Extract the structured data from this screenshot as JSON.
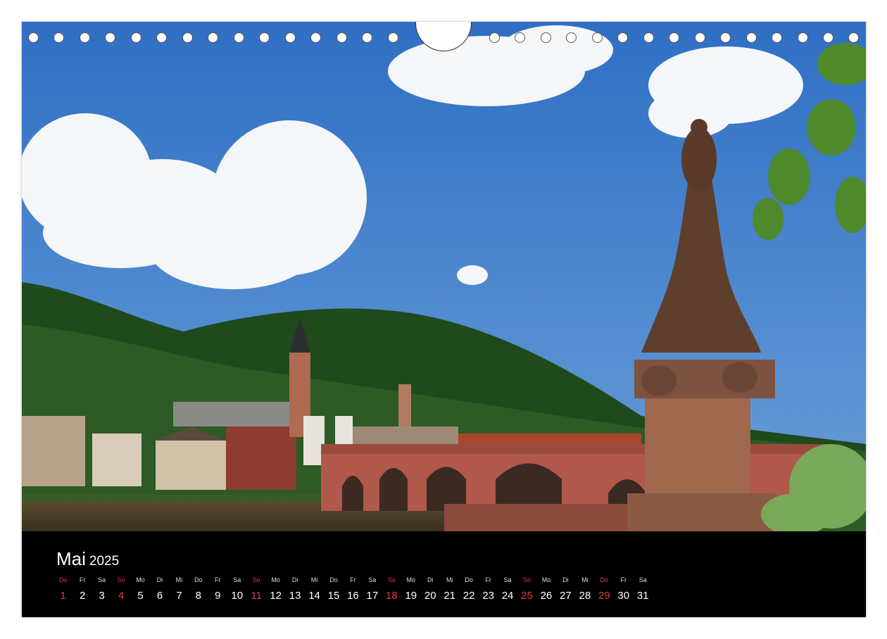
{
  "calendar": {
    "month": "Mai",
    "year": "2025",
    "colors": {
      "sunday": "#e23a3a",
      "text": "#ffffff",
      "background": "#000000"
    },
    "days": [
      {
        "abbr": "Do",
        "num": "1",
        "sunday": true
      },
      {
        "abbr": "Fr",
        "num": "2",
        "sunday": false
      },
      {
        "abbr": "Sa",
        "num": "3",
        "sunday": false
      },
      {
        "abbr": "So",
        "num": "4",
        "sunday": true
      },
      {
        "abbr": "Mo",
        "num": "5",
        "sunday": false
      },
      {
        "abbr": "Di",
        "num": "6",
        "sunday": false
      },
      {
        "abbr": "Mi",
        "num": "7",
        "sunday": false
      },
      {
        "abbr": "Do",
        "num": "8",
        "sunday": false
      },
      {
        "abbr": "Fr",
        "num": "9",
        "sunday": false
      },
      {
        "abbr": "Sa",
        "num": "10",
        "sunday": false
      },
      {
        "abbr": "So",
        "num": "11",
        "sunday": true
      },
      {
        "abbr": "Mo",
        "num": "12",
        "sunday": false
      },
      {
        "abbr": "Di",
        "num": "13",
        "sunday": false
      },
      {
        "abbr": "Mi",
        "num": "14",
        "sunday": false
      },
      {
        "abbr": "Do",
        "num": "15",
        "sunday": false
      },
      {
        "abbr": "Fr",
        "num": "16",
        "sunday": false
      },
      {
        "abbr": "Sa",
        "num": "17",
        "sunday": false
      },
      {
        "abbr": "So",
        "num": "18",
        "sunday": true
      },
      {
        "abbr": "Mo",
        "num": "19",
        "sunday": false
      },
      {
        "abbr": "Di",
        "num": "20",
        "sunday": false
      },
      {
        "abbr": "Mi",
        "num": "21",
        "sunday": false
      },
      {
        "abbr": "Do",
        "num": "22",
        "sunday": false
      },
      {
        "abbr": "Fr",
        "num": "23",
        "sunday": false
      },
      {
        "abbr": "Sa",
        "num": "24",
        "sunday": false
      },
      {
        "abbr": "So",
        "num": "25",
        "sunday": true
      },
      {
        "abbr": "Mo",
        "num": "26",
        "sunday": false
      },
      {
        "abbr": "Di",
        "num": "27",
        "sunday": false
      },
      {
        "abbr": "Mi",
        "num": "28",
        "sunday": false
      },
      {
        "abbr": "Do",
        "num": "29",
        "sunday": true
      },
      {
        "abbr": "Fr",
        "num": "30",
        "sunday": false
      },
      {
        "abbr": "Sa",
        "num": "31",
        "sunday": false
      }
    ]
  }
}
